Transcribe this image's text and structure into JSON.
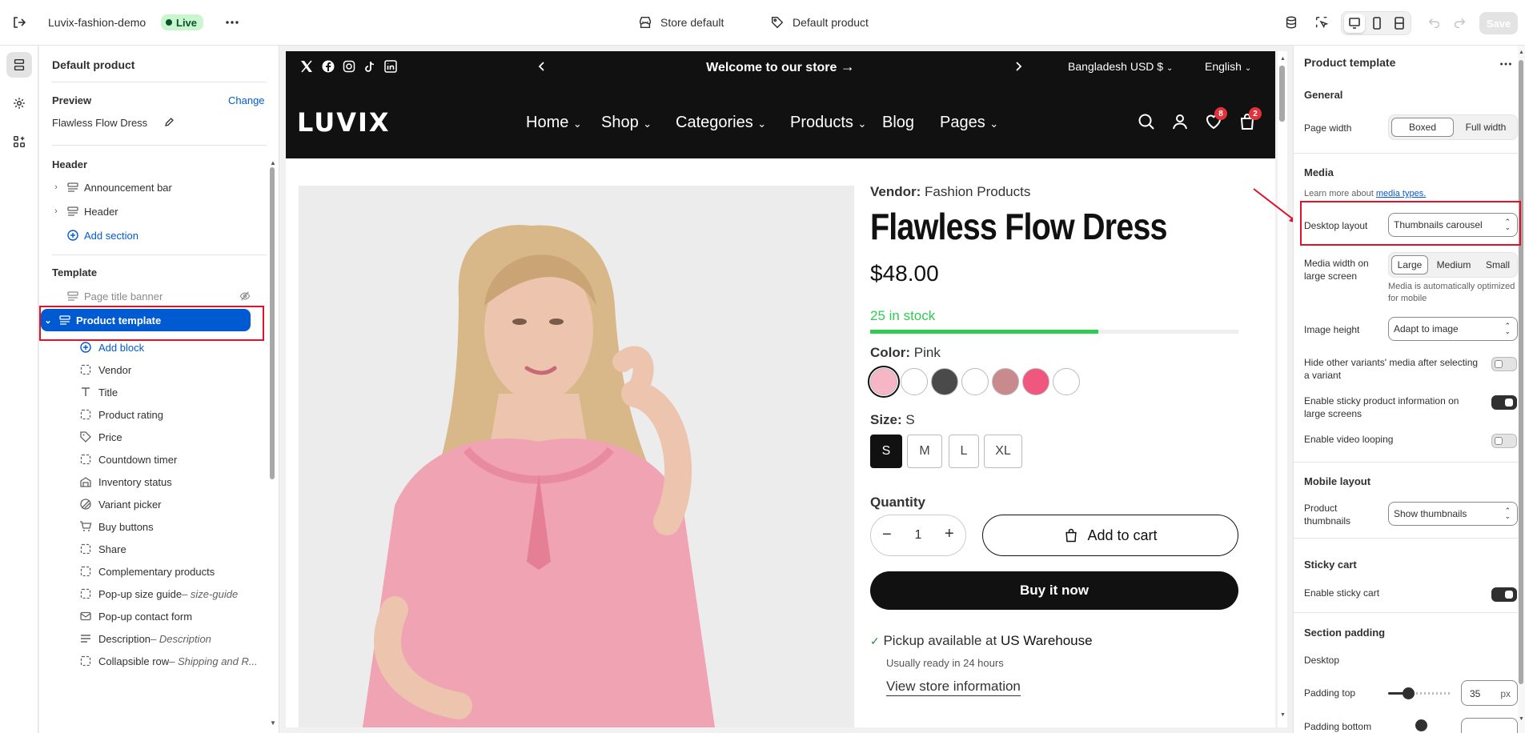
{
  "topbar": {
    "store_name": "Luvix-fashion-demo",
    "live": "Live",
    "theme_label": "Store default",
    "template_label": "Default product",
    "save": "Save"
  },
  "left_panel": {
    "title": "Default product",
    "preview_label": "Preview",
    "change": "Change",
    "product_name": "Flawless Flow Dress",
    "header_heading": "Header",
    "header_items": [
      "Announcement bar",
      "Header"
    ],
    "add_section": "Add section",
    "template_heading": "Template",
    "template_items": [
      "Page title banner",
      "Product template"
    ],
    "add_block": "Add block",
    "blocks": [
      {
        "label": "Vendor",
        "suffix": "",
        "icon": "dashed-square-icon"
      },
      {
        "label": "Title",
        "suffix": "",
        "icon": "text-icon"
      },
      {
        "label": "Product rating",
        "suffix": "",
        "icon": "dashed-square-icon"
      },
      {
        "label": "Price",
        "suffix": "",
        "icon": "price-tag-icon"
      },
      {
        "label": "Countdown timer",
        "suffix": "",
        "icon": "dashed-square-icon"
      },
      {
        "label": "Inventory status",
        "suffix": "",
        "icon": "inventory-icon"
      },
      {
        "label": "Variant picker",
        "suffix": "",
        "icon": "variant-icon"
      },
      {
        "label": "Buy buttons",
        "suffix": "",
        "icon": "cart-icon"
      },
      {
        "label": "Share",
        "suffix": "",
        "icon": "dashed-square-icon"
      },
      {
        "label": "Complementary products",
        "suffix": "",
        "icon": "dashed-square-icon"
      },
      {
        "label": "Pop-up size guide",
        "suffix": " – size-guide",
        "icon": "dashed-square-icon"
      },
      {
        "label": "Pop-up contact form",
        "suffix": "",
        "icon": "mail-icon"
      },
      {
        "label": "Description",
        "suffix": " – Description",
        "icon": "paragraph-icon"
      },
      {
        "label": "Collapsible row",
        "suffix": " – Shipping and R...",
        "icon": "dashed-square-icon"
      }
    ]
  },
  "preview": {
    "announcement": "Welcome to our store",
    "currency": "Bangladesh USD $",
    "language": "English",
    "logo": "LUVIX",
    "nav": [
      "Home",
      "Shop",
      "Categories",
      "Products",
      "Blog",
      "Pages"
    ],
    "wishlist_count": "8",
    "cart_count": "2",
    "vendor_label": "Vendor:",
    "vendor": "Fashion Products",
    "product_title": "Flawless Flow Dress",
    "price": "$48.00",
    "stock": "25 in stock",
    "stock_level": 0.62,
    "color_label": "Color:",
    "color_value": "Pink",
    "swatches": [
      "#f7b6c6",
      "#ffffff",
      "#4a4a4a",
      "#ffffff",
      "#c98a8e",
      "#f0577f",
      "#ffffff"
    ],
    "size_label": "Size:",
    "size_value": "S",
    "sizes": [
      "S",
      "M",
      "L",
      "XL"
    ],
    "quantity_label": "Quantity",
    "quantity": "1",
    "add_to_cart": "Add to cart",
    "buy_now": "Buy it now",
    "pickup_prefix": "Pickup available at ",
    "pickup_location": "US Warehouse",
    "pickup_ready": "Usually ready in 24 hours",
    "store_info": "View store information"
  },
  "right_panel": {
    "title": "Product template",
    "general": "General",
    "page_width": "Page width",
    "pw_options": [
      "Boxed",
      "Full width"
    ],
    "pw_selected": "Boxed",
    "media": "Media",
    "learn_prefix": "Learn more about ",
    "learn_link": "media types.",
    "desktop_layout": "Desktop layout",
    "desktop_layout_value": "Thumbnails carousel",
    "media_width": "Media width on large screen",
    "mw_options": [
      "Large",
      "Medium",
      "Small"
    ],
    "mw_selected": "Large",
    "media_note": "Media is automatically optimized for mobile",
    "image_height": "Image height",
    "image_height_value": "Adapt to image",
    "hide_variants": "Hide other variants' media after selecting a variant",
    "hide_variants_on": false,
    "sticky_info": "Enable sticky product information on large screens",
    "sticky_info_on": true,
    "video_loop": "Enable video looping",
    "video_loop_on": false,
    "mobile_layout": "Mobile layout",
    "product_thumbnails": "Product thumbnails",
    "thumbnails_value": "Show thumbnails",
    "sticky_cart": "Sticky cart",
    "enable_sticky_cart": "Enable sticky cart",
    "sticky_cart_on": true,
    "section_padding": "Section padding",
    "desktop": "Desktop",
    "padding_top": "Padding top",
    "padding_top_value": "35",
    "unit": "px",
    "padding_bottom": "Padding bottom"
  }
}
